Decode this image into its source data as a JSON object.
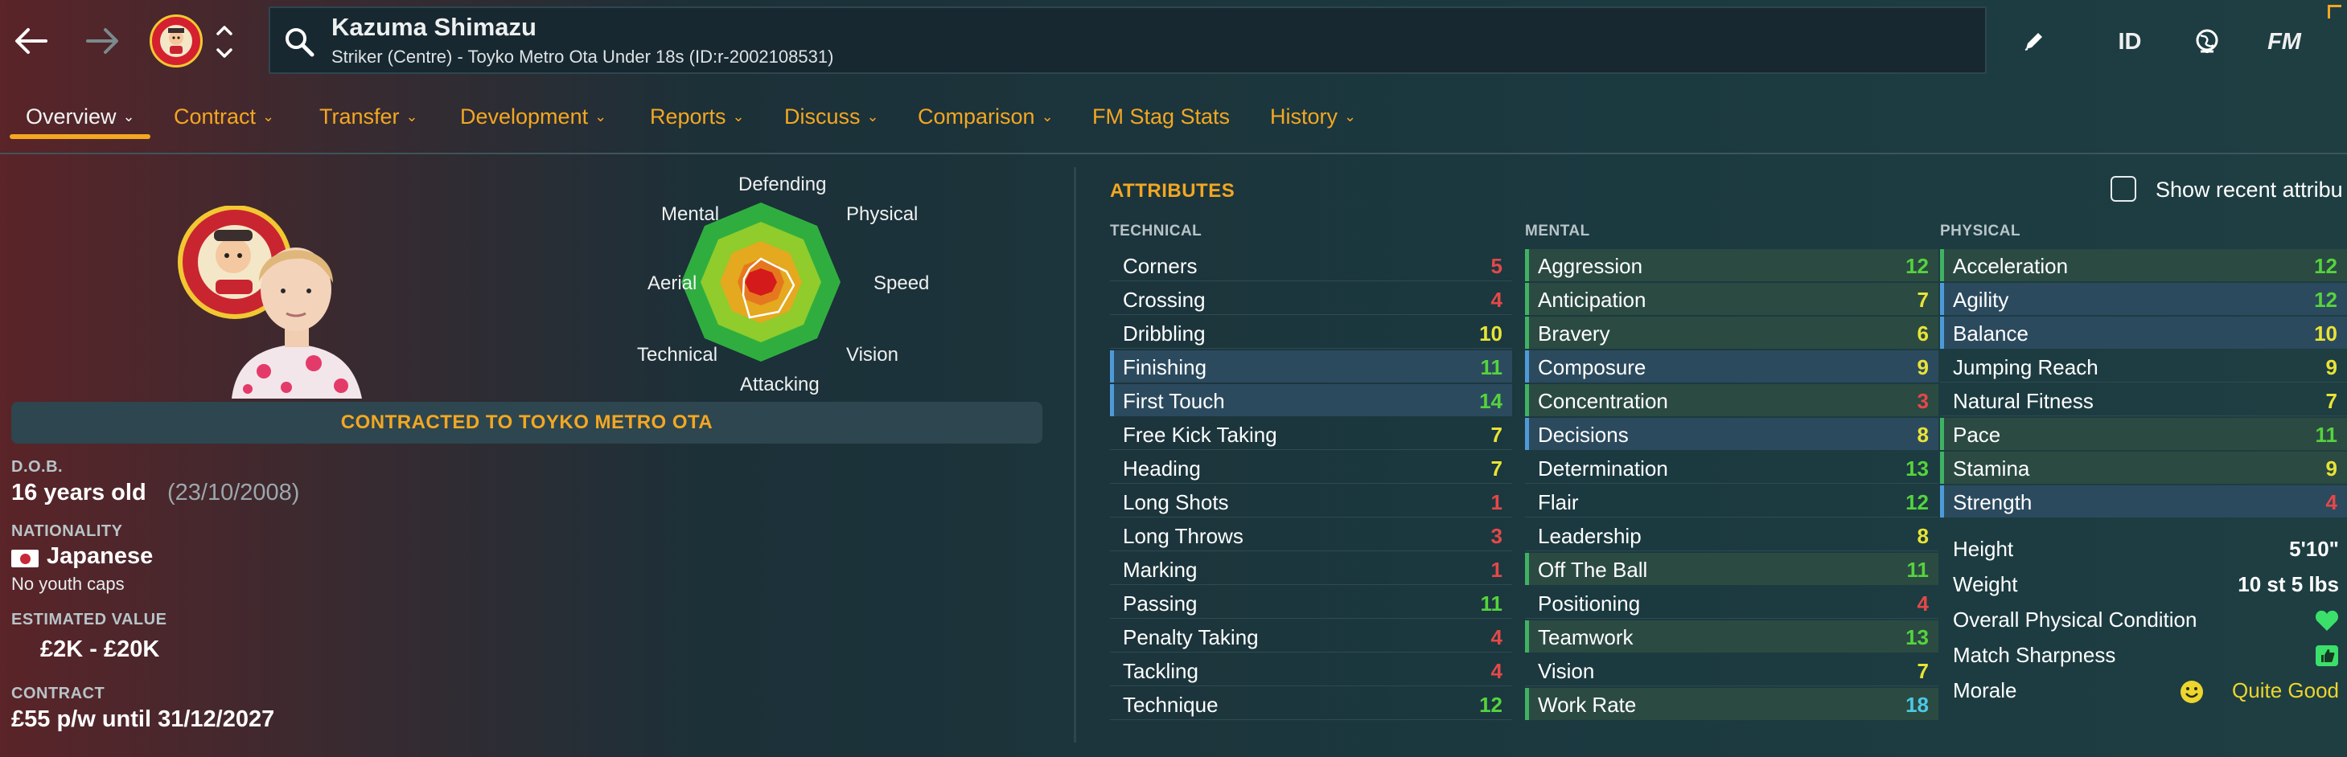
{
  "header": {
    "player_name": "Kazuma Shimazu",
    "subtitle": "Striker (Centre) - Toyko Metro Ota Under 18s (ID:r-2002108531)",
    "id_label": "ID",
    "fm_label": "FM",
    "icons": [
      "back-arrow-icon",
      "forward-arrow-icon",
      "club-badge",
      "up-down-chevron-icon",
      "search-icon",
      "pencil-icon",
      "globe-icon"
    ]
  },
  "tabs": [
    {
      "label": "Overview",
      "active": true,
      "dropdown": true
    },
    {
      "label": "Contract",
      "dropdown": true
    },
    {
      "label": "Transfer",
      "dropdown": true
    },
    {
      "label": "Development",
      "dropdown": true
    },
    {
      "label": "Reports",
      "dropdown": true
    },
    {
      "label": "Discuss",
      "dropdown": true
    },
    {
      "label": "Comparison",
      "dropdown": true
    },
    {
      "label": "FM Stag Stats",
      "dropdown": false
    },
    {
      "label": "History",
      "dropdown": true
    }
  ],
  "radar": {
    "labels": [
      "Defending",
      "Physical",
      "Speed",
      "Vision",
      "Attacking",
      "Technical",
      "Aerial",
      "Mental"
    ]
  },
  "contract_banner": "CONTRACTED TO TOYKO METRO OTA",
  "profile": {
    "dob_label": "D.O.B.",
    "age": "16 years old",
    "dob": "(23/10/2008)",
    "nationality_label": "NATIONALITY",
    "nationality": "Japanese",
    "caps": "No youth caps",
    "value_label": "ESTIMATED VALUE",
    "value": "£2K - £20K",
    "contract_label": "CONTRACT",
    "contract": "£55 p/w until 31/12/2027"
  },
  "attributes": {
    "title": "ATTRIBUTES",
    "show_recent_label": "Show recent attribu",
    "technical_label": "TECHNICAL",
    "mental_label": "MENTAL",
    "physical_label": "PHYSICAL",
    "technical": [
      {
        "name": "Corners",
        "value": "5",
        "hl": "plain"
      },
      {
        "name": "Crossing",
        "value": "4",
        "hl": "plain"
      },
      {
        "name": "Dribbling",
        "value": "10",
        "hl": "plain"
      },
      {
        "name": "Finishing",
        "value": "11",
        "hl": "blue"
      },
      {
        "name": "First Touch",
        "value": "14",
        "hl": "blue"
      },
      {
        "name": "Free Kick Taking",
        "value": "7",
        "hl": "plain"
      },
      {
        "name": "Heading",
        "value": "7",
        "hl": "plain"
      },
      {
        "name": "Long Shots",
        "value": "1",
        "hl": "plain"
      },
      {
        "name": "Long Throws",
        "value": "3",
        "hl": "plain"
      },
      {
        "name": "Marking",
        "value": "1",
        "hl": "plain"
      },
      {
        "name": "Passing",
        "value": "11",
        "hl": "plain"
      },
      {
        "name": "Penalty Taking",
        "value": "4",
        "hl": "plain"
      },
      {
        "name": "Tackling",
        "value": "4",
        "hl": "plain"
      },
      {
        "name": "Technique",
        "value": "12",
        "hl": "plain"
      }
    ],
    "mental": [
      {
        "name": "Aggression",
        "value": "12",
        "hl": "green"
      },
      {
        "name": "Anticipation",
        "value": "7",
        "hl": "green"
      },
      {
        "name": "Bravery",
        "value": "6",
        "hl": "green"
      },
      {
        "name": "Composure",
        "value": "9",
        "hl": "blue"
      },
      {
        "name": "Concentration",
        "value": "3",
        "hl": "green"
      },
      {
        "name": "Decisions",
        "value": "8",
        "hl": "blue"
      },
      {
        "name": "Determination",
        "value": "13",
        "hl": "plain"
      },
      {
        "name": "Flair",
        "value": "12",
        "hl": "plain"
      },
      {
        "name": "Leadership",
        "value": "8",
        "hl": "plain"
      },
      {
        "name": "Off The Ball",
        "value": "11",
        "hl": "green"
      },
      {
        "name": "Positioning",
        "value": "4",
        "hl": "plain"
      },
      {
        "name": "Teamwork",
        "value": "13",
        "hl": "green"
      },
      {
        "name": "Vision",
        "value": "7",
        "hl": "plain"
      },
      {
        "name": "Work Rate",
        "value": "18",
        "hl": "green"
      }
    ],
    "physical": [
      {
        "name": "Acceleration",
        "value": "12",
        "hl": "green"
      },
      {
        "name": "Agility",
        "value": "12",
        "hl": "blue"
      },
      {
        "name": "Balance",
        "value": "10",
        "hl": "blue"
      },
      {
        "name": "Jumping Reach",
        "value": "9",
        "hl": "plain"
      },
      {
        "name": "Natural Fitness",
        "value": "7",
        "hl": "plain"
      },
      {
        "name": "Pace",
        "value": "11",
        "hl": "green"
      },
      {
        "name": "Stamina",
        "value": "9",
        "hl": "green"
      },
      {
        "name": "Strength",
        "value": "4",
        "hl": "blue"
      }
    ]
  },
  "physical_info": [
    {
      "label": "Height",
      "value": "5'10\""
    },
    {
      "label": "Weight",
      "value": "10 st 5 lbs"
    },
    {
      "label": "Overall Physical Condition",
      "value": "",
      "icon": "heart-icon"
    },
    {
      "label": "Match Sharpness",
      "value": "",
      "icon": "thumbs-up-icon"
    },
    {
      "label": "Morale",
      "value": "Quite Good",
      "icon": "smiley-icon"
    }
  ],
  "colors": {
    "accent": "#f3a722",
    "value_red": "#e54848",
    "value_orange": "#f07a3a",
    "value_yellow": "#e9e336",
    "value_green": "#55d33e",
    "value_cyan": "#4cc9e6"
  }
}
